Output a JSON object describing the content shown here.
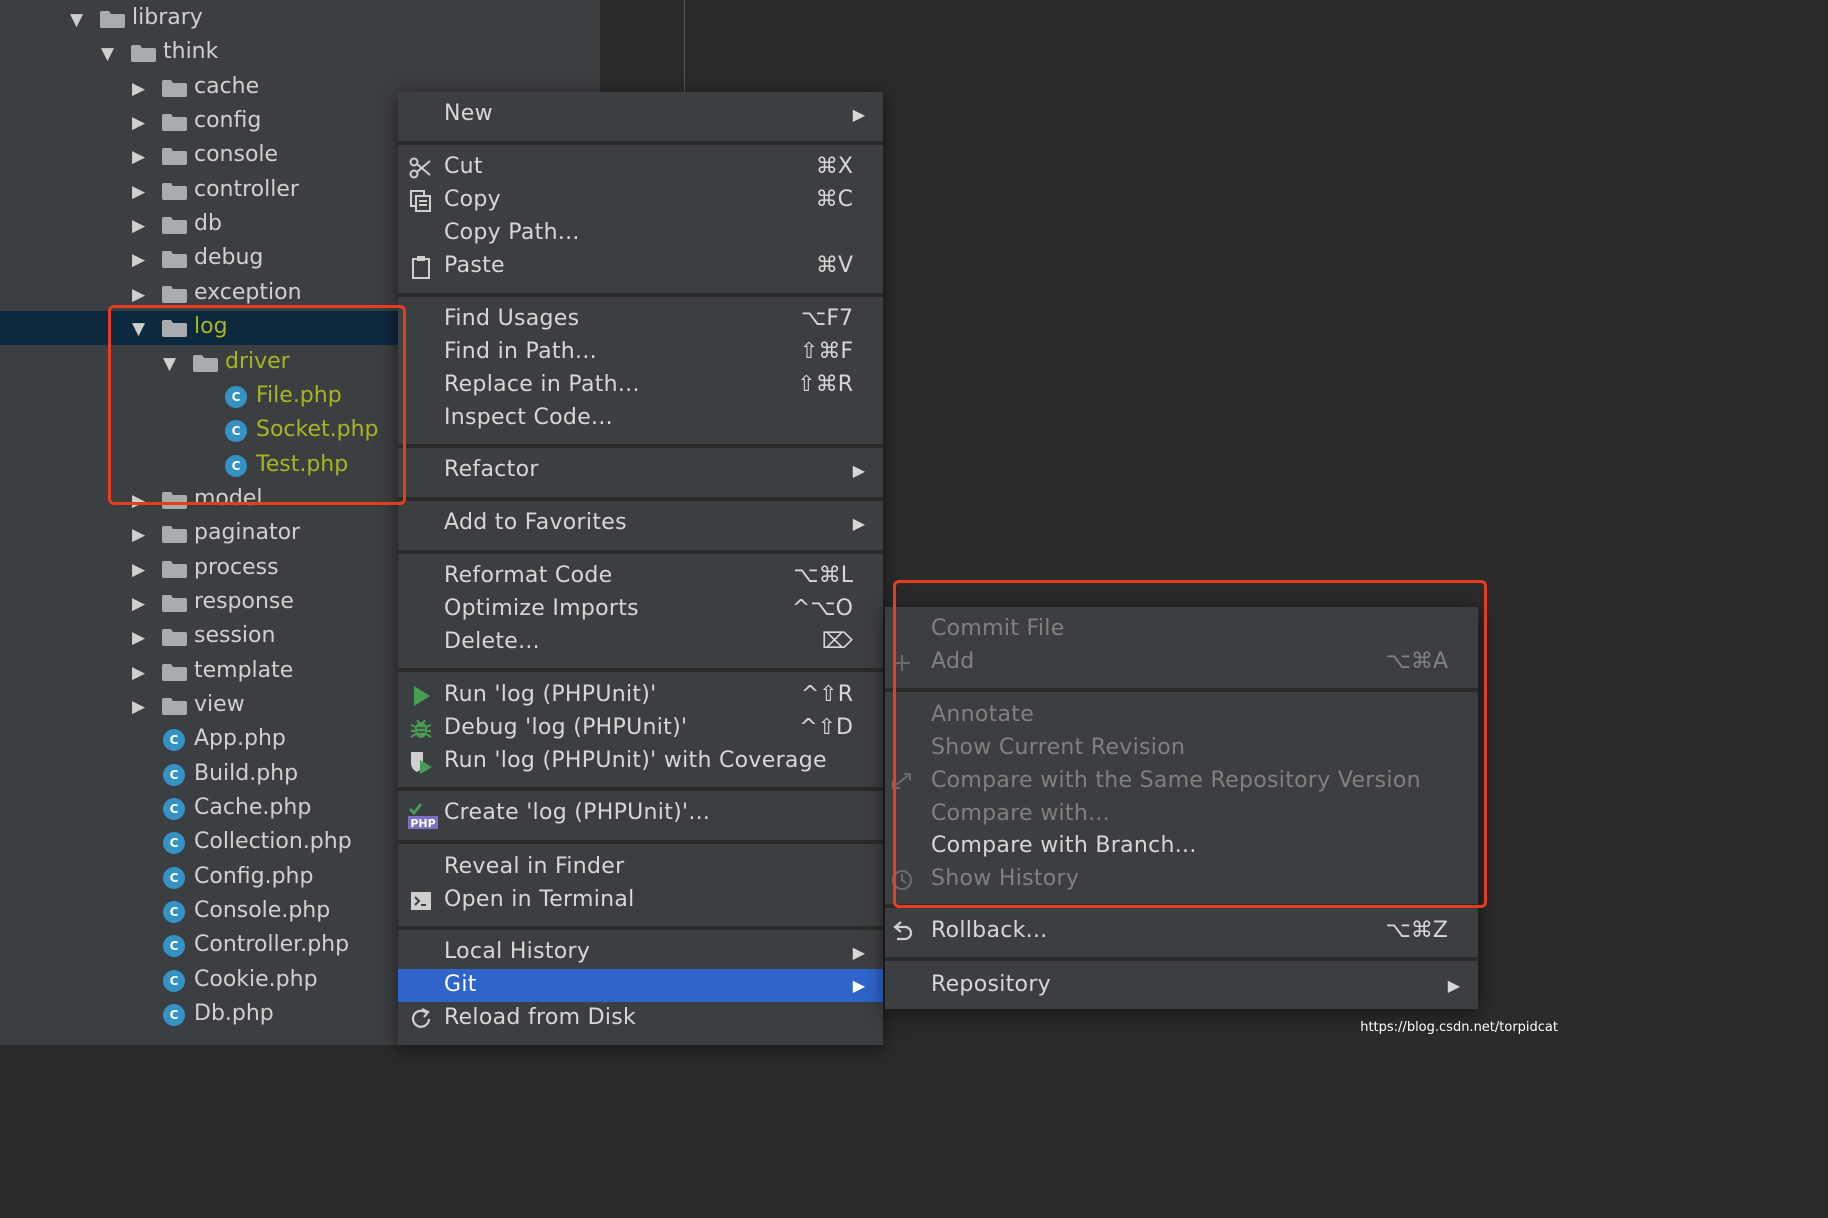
{
  "tree": {
    "rows": [
      {
        "name": "library",
        "type": "folder",
        "expanded": true
      },
      {
        "name": "think",
        "type": "folder",
        "expanded": true
      },
      {
        "name": "cache",
        "type": "folder",
        "expanded": false
      },
      {
        "name": "config",
        "type": "folder",
        "expanded": false
      },
      {
        "name": "console",
        "type": "folder",
        "expanded": false
      },
      {
        "name": "controller",
        "type": "folder",
        "expanded": false
      },
      {
        "name": "db",
        "type": "folder",
        "expanded": false
      },
      {
        "name": "debug",
        "type": "folder",
        "expanded": false
      },
      {
        "name": "exception",
        "type": "folder",
        "expanded": false
      },
      {
        "name": "log",
        "type": "folder",
        "expanded": true,
        "selected": true
      },
      {
        "name": "driver",
        "type": "folder",
        "expanded": true
      },
      {
        "name": "File.php",
        "type": "class"
      },
      {
        "name": "Socket.php",
        "type": "class"
      },
      {
        "name": "Test.php",
        "type": "class"
      },
      {
        "name": "model",
        "type": "folder",
        "expanded": false
      },
      {
        "name": "paginator",
        "type": "folder",
        "expanded": false
      },
      {
        "name": "process",
        "type": "folder",
        "expanded": false
      },
      {
        "name": "response",
        "type": "folder",
        "expanded": false
      },
      {
        "name": "session",
        "type": "folder",
        "expanded": false
      },
      {
        "name": "template",
        "type": "folder",
        "expanded": false
      },
      {
        "name": "view",
        "type": "folder",
        "expanded": false
      },
      {
        "name": "App.php",
        "type": "class"
      },
      {
        "name": "Build.php",
        "type": "class"
      },
      {
        "name": "Cache.php",
        "type": "class"
      },
      {
        "name": "Collection.php",
        "type": "class"
      },
      {
        "name": "Config.php",
        "type": "class"
      },
      {
        "name": "Console.php",
        "type": "class"
      },
      {
        "name": "Controller.php",
        "type": "class"
      },
      {
        "name": "Cookie.php",
        "type": "class"
      },
      {
        "name": "Db.php",
        "type": "class"
      }
    ],
    "class_icon_letter": "C"
  },
  "context_menu": {
    "items": [
      {
        "label": "New",
        "submenu": true
      },
      {
        "label": "Cut",
        "shortcut": "⌘X",
        "icon": "scissors-icon"
      },
      {
        "label": "Copy",
        "shortcut": "⌘C",
        "icon": "copy-icon"
      },
      {
        "label": "Copy Path..."
      },
      {
        "label": "Paste",
        "shortcut": "⌘V",
        "icon": "clipboard-icon"
      },
      {
        "label": "Find Usages",
        "shortcut": "⌥F7"
      },
      {
        "label": "Find in Path...",
        "shortcut": "⇧⌘F"
      },
      {
        "label": "Replace in Path...",
        "shortcut": "⇧⌘R"
      },
      {
        "label": "Inspect Code..."
      },
      {
        "label": "Refactor",
        "submenu": true
      },
      {
        "label": "Add to Favorites",
        "submenu": true
      },
      {
        "label": "Reformat Code",
        "shortcut": "⌥⌘L"
      },
      {
        "label": "Optimize Imports",
        "shortcut": "^⌥O"
      },
      {
        "label": "Delete...",
        "shortcut": "⌦"
      },
      {
        "label": "Run 'log (PHPUnit)'",
        "shortcut": "^⇧R",
        "icon": "run-icon"
      },
      {
        "label": "Debug 'log (PHPUnit)'",
        "shortcut": "^⇧D",
        "icon": "debug-icon"
      },
      {
        "label": "Run 'log (PHPUnit)' with Coverage",
        "icon": "coverage-icon"
      },
      {
        "label": "Create 'log (PHPUnit)'...",
        "icon": "php-config-icon",
        "icon_text": "PHP"
      },
      {
        "label": "Reveal in Finder"
      },
      {
        "label": "Open in Terminal",
        "icon": "terminal-icon"
      },
      {
        "label": "Local History",
        "submenu": true
      },
      {
        "label": "Git",
        "submenu": true,
        "highlighted": true
      },
      {
        "label": "Reload from Disk",
        "icon": "reload-icon"
      }
    ]
  },
  "git_submenu": {
    "items": [
      {
        "label": "Commit File",
        "disabled": true
      },
      {
        "label": "Add",
        "shortcut": "⌥⌘A",
        "disabled": true,
        "icon": "plus-icon"
      },
      {
        "label": "Annotate",
        "disabled": true
      },
      {
        "label": "Show Current Revision",
        "disabled": true
      },
      {
        "label": "Compare with the Same Repository Version",
        "disabled": true,
        "icon": "compare-icon"
      },
      {
        "label": "Compare with...",
        "disabled": true
      },
      {
        "label": "Compare with Branch...",
        "disabled": false
      },
      {
        "label": "Show History",
        "disabled": true,
        "icon": "history-icon"
      },
      {
        "label": "Rollback...",
        "shortcut": "⌥⌘Z",
        "icon": "rollback-icon"
      },
      {
        "label": "Repository",
        "submenu": true
      }
    ]
  },
  "submenu_arrow": "▶",
  "watermark": "https://blog.csdn.net/torpidcat",
  "colors": {
    "selection": "#0d293e",
    "highlight": "#2f65ca",
    "annotation": "#e53e1f",
    "vcs_new_file": "#a8b51f",
    "class_icon": "#3592c4"
  }
}
